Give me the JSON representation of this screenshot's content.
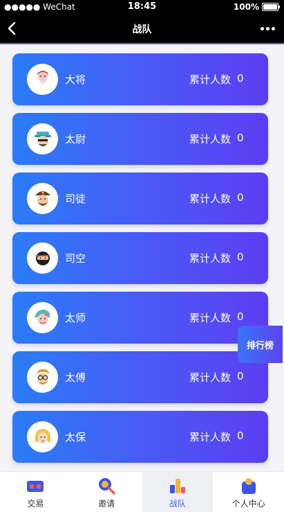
{
  "status_bar": {
    "carrier": "●●●●● WeChat",
    "time": "18:45",
    "battery": "100%"
  },
  "nav": {
    "title": "战队",
    "back_icon": "chevron-left-icon",
    "more_icon": "more-dots-icon"
  },
  "teams": [
    {
      "name": "大将",
      "count_label": "累计人数",
      "count": "0",
      "avatar": "red-beard-avatar"
    },
    {
      "name": "太尉",
      "count_label": "累计人数",
      "count": "0",
      "avatar": "hat-man-avatar"
    },
    {
      "name": "司徒",
      "count_label": "累计人数",
      "count": "0",
      "avatar": "pirate-avatar"
    },
    {
      "name": "司空",
      "count_label": "累计人数",
      "count": "0",
      "avatar": "ninja-avatar"
    },
    {
      "name": "太师",
      "count_label": "累计人数",
      "count": "0",
      "avatar": "granny-avatar"
    },
    {
      "name": "太傅",
      "count_label": "累计人数",
      "count": "0",
      "avatar": "glasses-man-avatar"
    },
    {
      "name": "太保",
      "count_label": "累计人数",
      "count": "0",
      "avatar": "blonde-girl-avatar"
    }
  ],
  "rank_button": "排行榜",
  "tabs": [
    {
      "label": "交易",
      "icon": "vr-goggles-icon"
    },
    {
      "label": "邀请",
      "icon": "magnifier-icon"
    },
    {
      "label": "战队",
      "icon": "bar-chart-icon",
      "active": true
    },
    {
      "label": "个人中心",
      "icon": "user-icon"
    }
  ],
  "colors": {
    "card_gradient_start": "#2a7cf6",
    "card_gradient_end": "#5b3ef2",
    "active_tab": "#4a5be8"
  }
}
